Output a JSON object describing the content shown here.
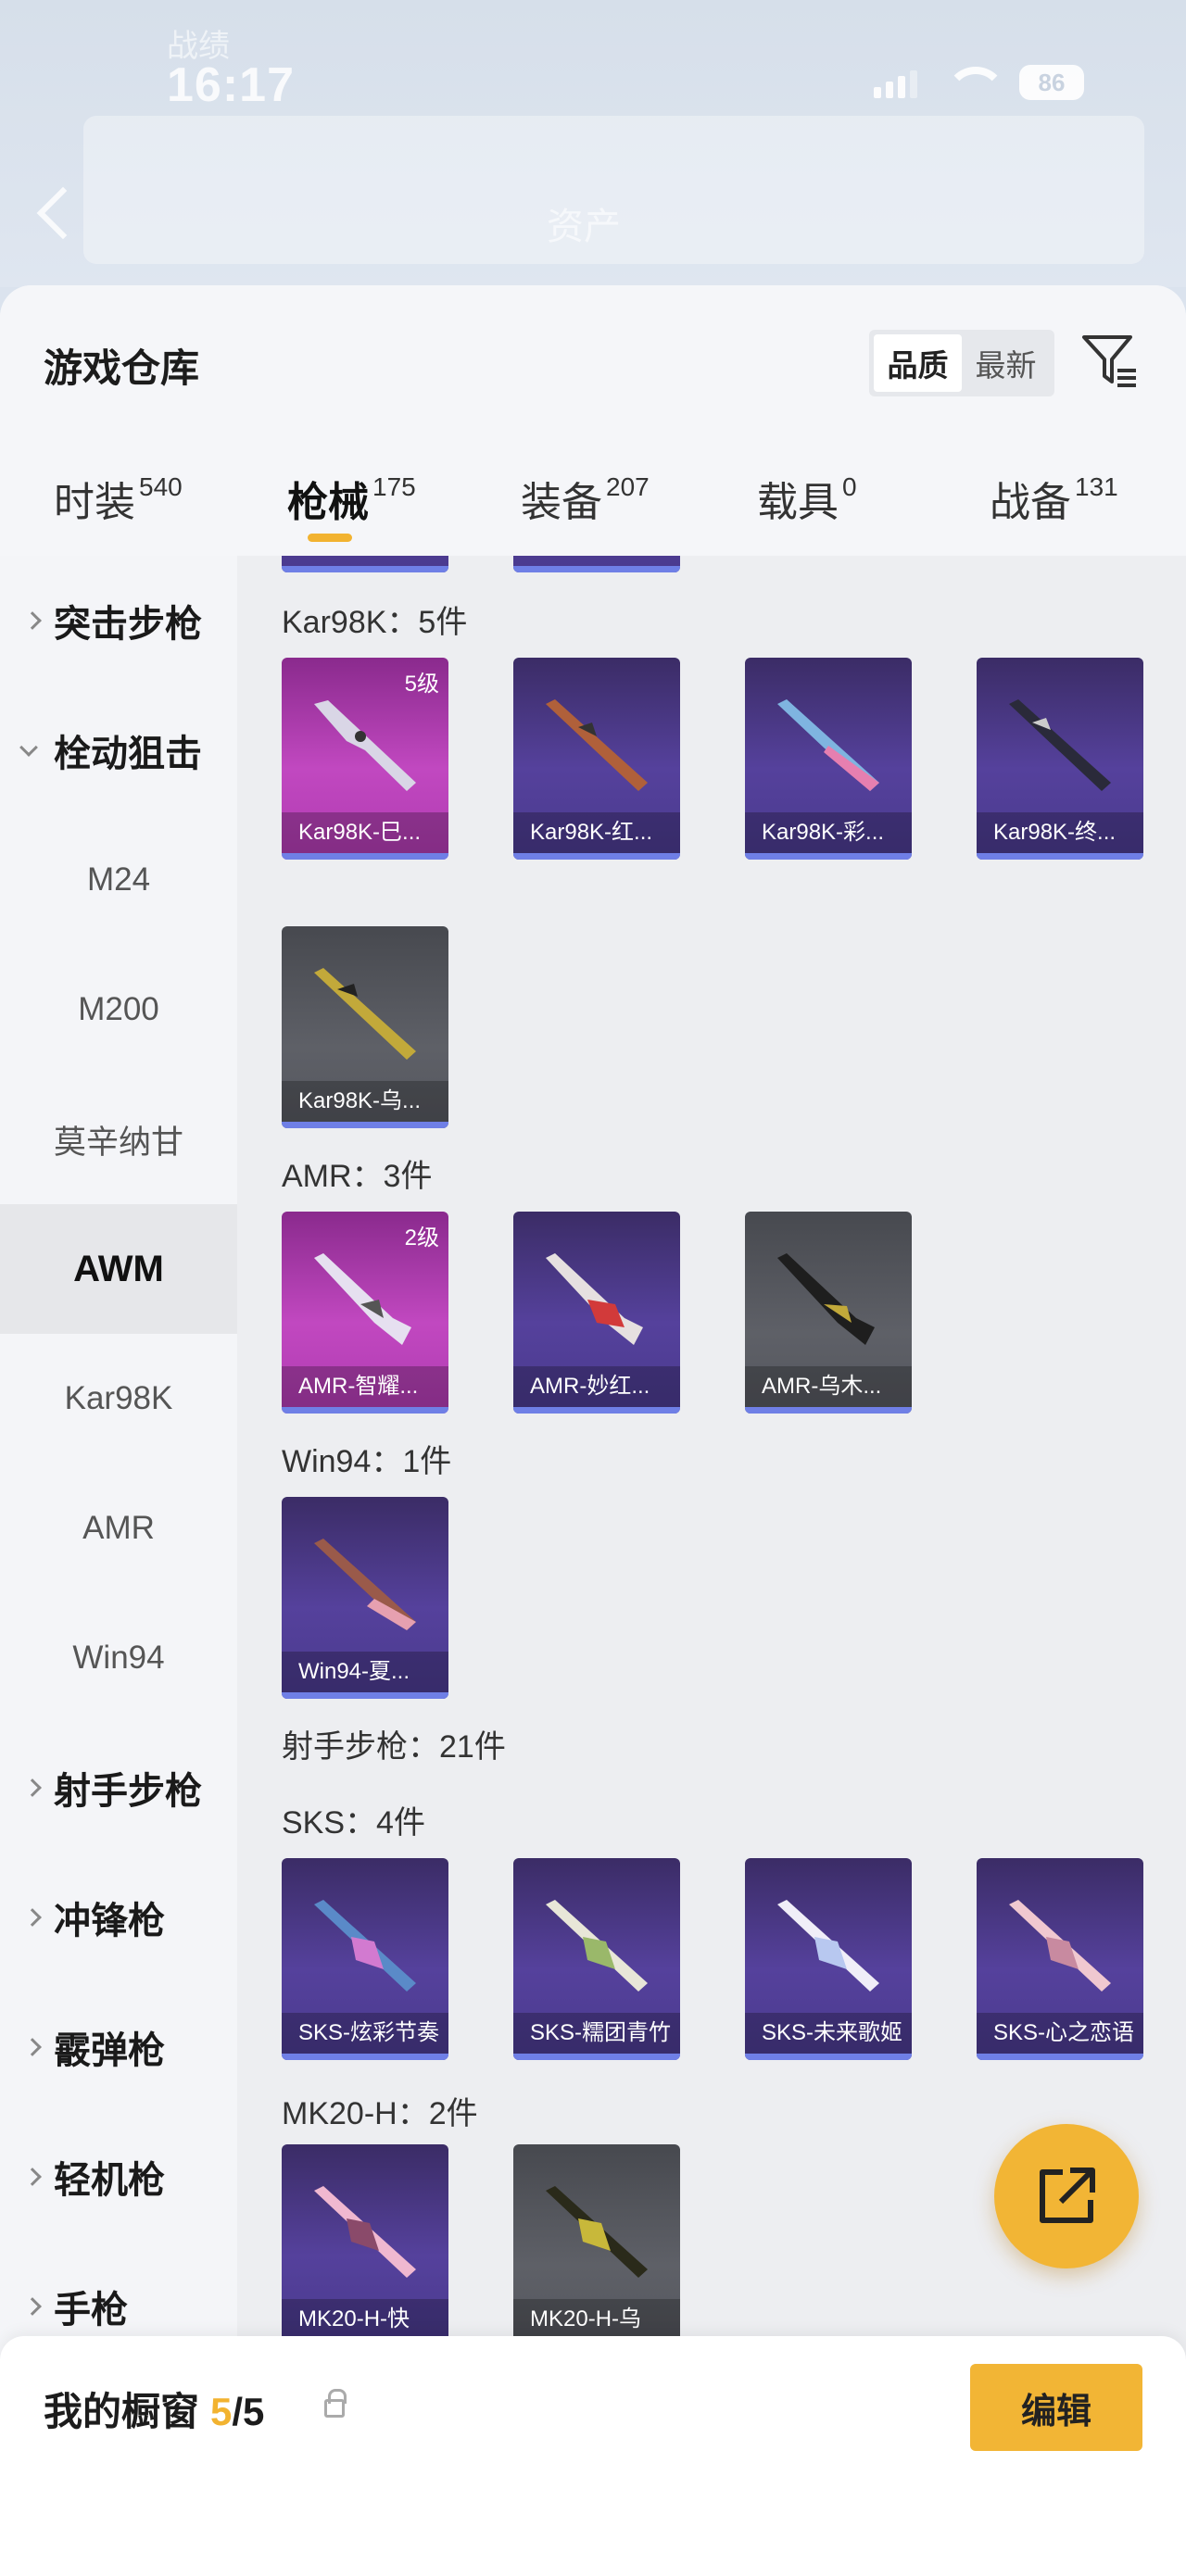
{
  "status_bar": {
    "time": "16:17",
    "battery": "86"
  },
  "header_ghost": {
    "left": "战绩",
    "mid": "资产"
  },
  "sheet": {
    "title": "游戏仓库",
    "sort": {
      "quality": "品质",
      "newest": "最新"
    }
  },
  "tabs": [
    {
      "label": "时装",
      "count": "540"
    },
    {
      "label": "枪械",
      "count": "175"
    },
    {
      "label": "装备",
      "count": "207"
    },
    {
      "label": "载具",
      "count": "0"
    },
    {
      "label": "战备",
      "count": "131"
    }
  ],
  "side_nav": {
    "cat_assault": "突击步枪",
    "cat_bolt": "栓动狙击",
    "sub_m24": "M24",
    "sub_m200": "M200",
    "sub_mosin": "莫辛纳甘",
    "sub_awm": "AWM",
    "sub_kar98k": "Kar98K",
    "sub_amr": "AMR",
    "sub_win94": "Win94",
    "cat_dmr": "射手步枪",
    "cat_smg": "冲锋枪",
    "cat_shotgun": "霰弹枪",
    "cat_lmg": "轻机枪",
    "cat_pistol": "手枪"
  },
  "groups": {
    "kar98k": {
      "label": "Kar98K：5件",
      "items": [
        {
          "name": "Kar98K-巳...",
          "level": "5级"
        },
        {
          "name": "Kar98K-红..."
        },
        {
          "name": "Kar98K-彩..."
        },
        {
          "name": "Kar98K-终..."
        },
        {
          "name": "Kar98K-乌..."
        }
      ]
    },
    "amr": {
      "label": "AMR：3件",
      "items": [
        {
          "name": "AMR-智耀...",
          "level": "2级"
        },
        {
          "name": "AMR-妙红..."
        },
        {
          "name": "AMR-乌木..."
        }
      ]
    },
    "win94": {
      "label": "Win94：1件",
      "items": [
        {
          "name": "Win94-夏..."
        }
      ]
    },
    "dmr_header": "射手步枪：21件",
    "sks": {
      "label": "SKS：4件",
      "items": [
        {
          "name": "SKS-炫彩节奏"
        },
        {
          "name": "SKS-糯团青竹"
        },
        {
          "name": "SKS-未来歌姬"
        },
        {
          "name": "SKS-心之恋语"
        }
      ]
    },
    "mk20": {
      "label": "MK20-H：2件",
      "items": [
        {
          "name": "MK20-H-快"
        },
        {
          "name": "MK20-H-乌"
        }
      ]
    }
  },
  "bottom": {
    "label": "我的橱窗",
    "current": "5",
    "total": "/5",
    "edit": "编辑"
  },
  "colors": {
    "accent": "#f2b535",
    "epic": "#c148c0",
    "rare": "#55419c",
    "common": "#5e6067"
  }
}
